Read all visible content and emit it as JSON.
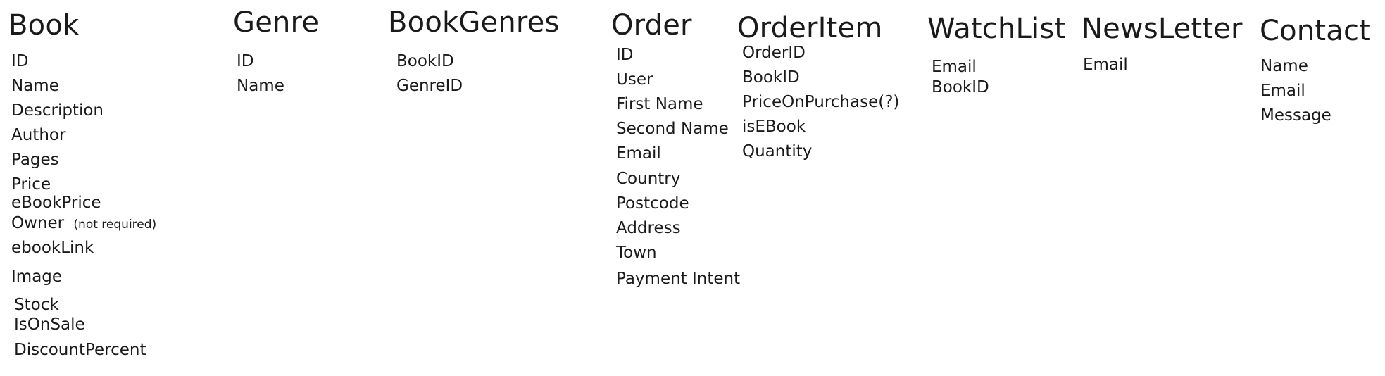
{
  "entities": {
    "book": {
      "title": "Book",
      "fields": [
        "ID",
        "Name",
        "Description",
        "Author",
        "Pages",
        "Price",
        "eBookPrice",
        "Owner",
        "ebookLink",
        "Image",
        "Stock",
        "IsOnSale",
        "DiscountPercent"
      ],
      "owner_note": "(not required)"
    },
    "genre": {
      "title": "Genre",
      "fields": [
        "ID",
        "Name"
      ]
    },
    "bookgenres": {
      "title": "BookGenres",
      "fields": [
        "BookID",
        "GenreID"
      ]
    },
    "order": {
      "title": "Order",
      "fields": [
        "ID",
        "User",
        "First Name",
        "Second Name",
        "Email",
        "Country",
        "Postcode",
        "Address",
        "Town",
        "Payment Intent"
      ]
    },
    "orderitem": {
      "title": "OrderItem",
      "fields": [
        "OrderID",
        "BookID",
        "PriceOnPurchase(?)",
        "isEBook",
        "Quantity"
      ]
    },
    "watchlist": {
      "title": "WatchList",
      "fields": [
        "Email",
        "BookID"
      ]
    },
    "newsletter": {
      "title": "NewsLetter",
      "fields": [
        "Email"
      ]
    },
    "contact": {
      "title": "Contact",
      "fields": [
        "Name",
        "Email",
        "Message"
      ]
    }
  }
}
